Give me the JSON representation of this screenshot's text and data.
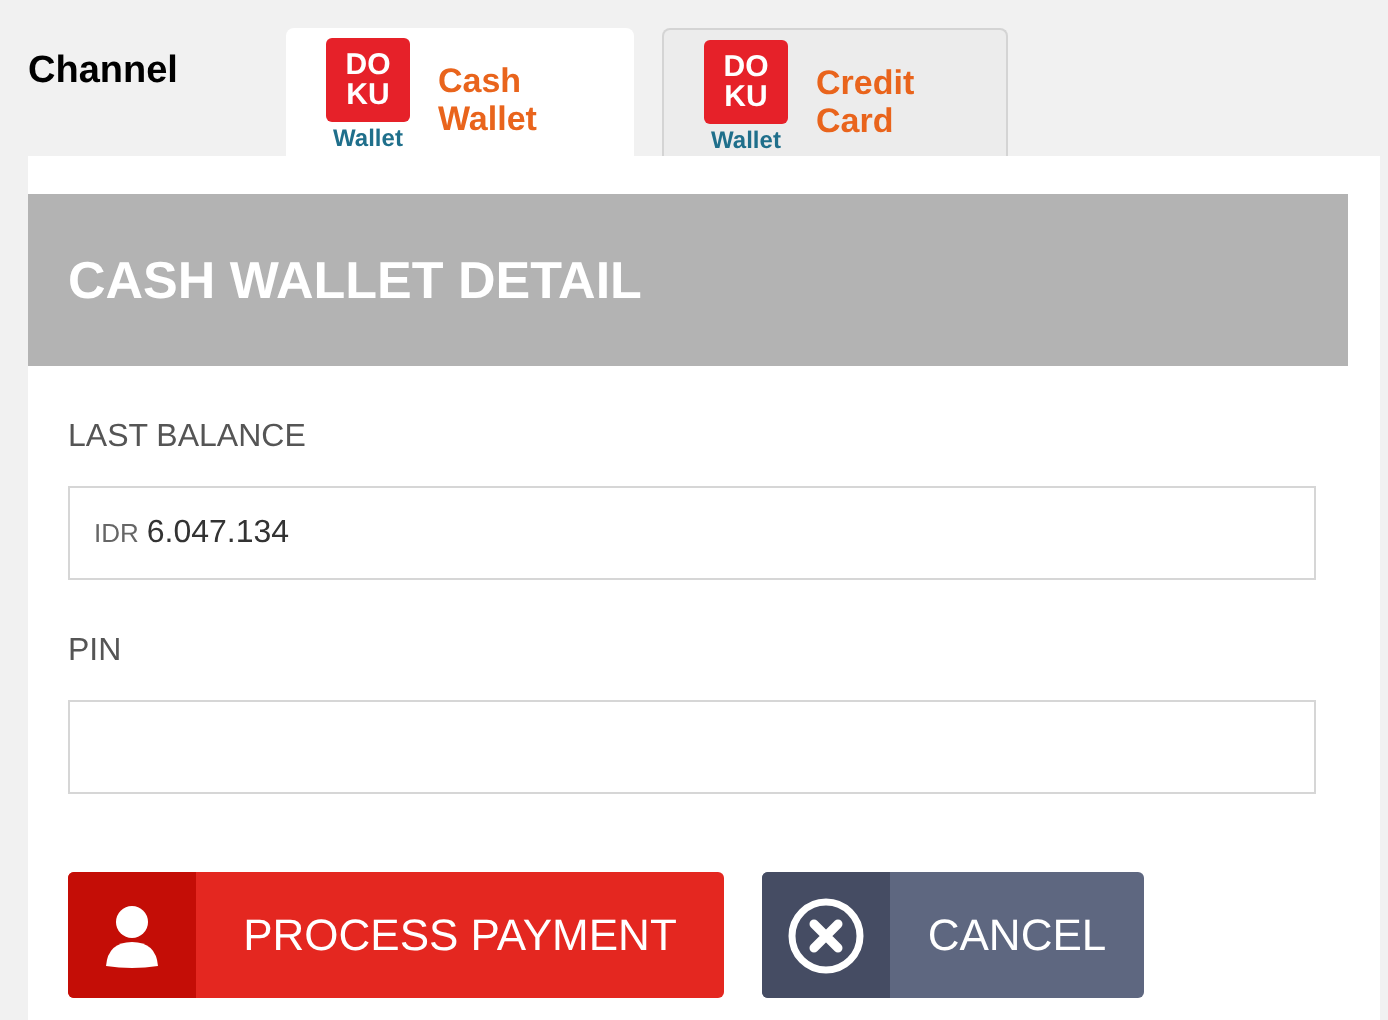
{
  "channel_label": "Channel",
  "tabs": [
    {
      "logo": {
        "top": "DO",
        "bottom": "KU",
        "caption": "Wallet"
      },
      "label": [
        "Cash",
        "Wallet"
      ],
      "selected": true
    },
    {
      "logo": {
        "top": "DO",
        "bottom": "KU",
        "caption": "Wallet"
      },
      "label": [
        "Credit",
        "Card"
      ],
      "selected": false
    }
  ],
  "panel": {
    "title": "CASH WALLET DETAIL",
    "fields": [
      {
        "label": "LAST BALANCE",
        "prefix": "IDR",
        "value": "6.047.134"
      },
      {
        "label": "PIN"
      }
    ],
    "buttons": [
      {
        "kind": "process",
        "label": "PROCESS PAYMENT"
      },
      {
        "kind": "cancel",
        "label": "CANCEL"
      }
    ]
  }
}
